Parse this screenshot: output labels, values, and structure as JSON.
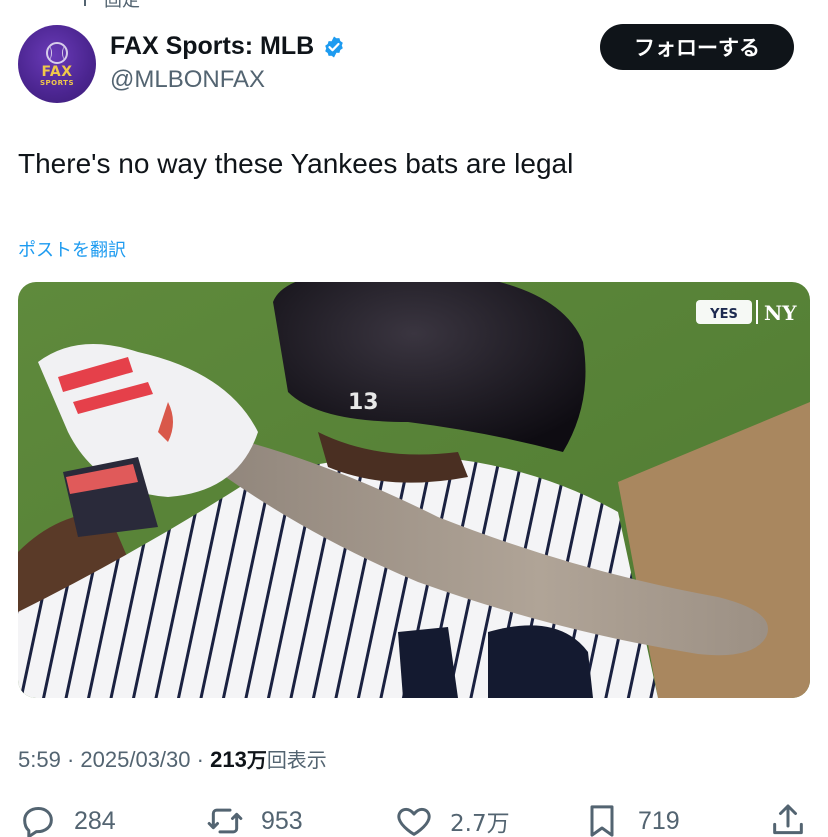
{
  "header": {
    "pinned_label": "固定"
  },
  "account": {
    "display_name": "FAX Sports: MLB",
    "handle": "@MLBONFAX",
    "avatar_text": [
      "FAX",
      "SPORTS"
    ],
    "verified": true,
    "follow_label": "フォローする"
  },
  "post": {
    "text": "There's no way these Yankees bats are legal",
    "translate_label": "ポストを翻訳",
    "media": {
      "watermark": "YES",
      "jersey_number": "13"
    }
  },
  "meta": {
    "time": "5:59",
    "separator": "·",
    "date": "2025/03/30",
    "views_number": "213",
    "views_unit": "万",
    "views_label": "回表示"
  },
  "actions": {
    "replies": "284",
    "reposts": "953",
    "likes": "2.7万",
    "bookmarks": "719"
  },
  "icons": {
    "reply": "reply-icon",
    "repost": "repost-icon",
    "like": "heart-icon",
    "bookmark": "bookmark-icon",
    "share": "share-icon",
    "verified": "verified-badge-icon"
  },
  "colors": {
    "text": "#0f1419",
    "secondary": "#536471",
    "link": "#1d9bf0",
    "verified": "#1d9bf0",
    "follow_bg": "#0f1419"
  }
}
